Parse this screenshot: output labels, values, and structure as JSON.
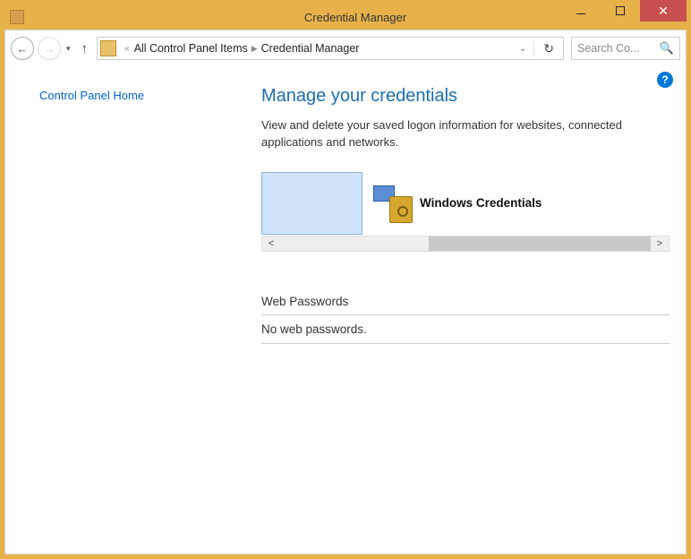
{
  "window": {
    "title": "Credential Manager"
  },
  "nav": {
    "back_glyph": "←",
    "chev": "«",
    "crumb1": "All Control Panel Items",
    "crumb2": "Credential Manager",
    "refresh_glyph": "↻",
    "search_placeholder": "Search Co..."
  },
  "sidebar": {
    "home": "Control Panel Home"
  },
  "main": {
    "heading": "Manage your credentials",
    "description": "View and delete your saved logon information for websites, connected applications and networks.",
    "win_credentials": "Windows Credentials",
    "section_header": "Web Passwords",
    "section_empty": "No web passwords."
  },
  "help": "?"
}
